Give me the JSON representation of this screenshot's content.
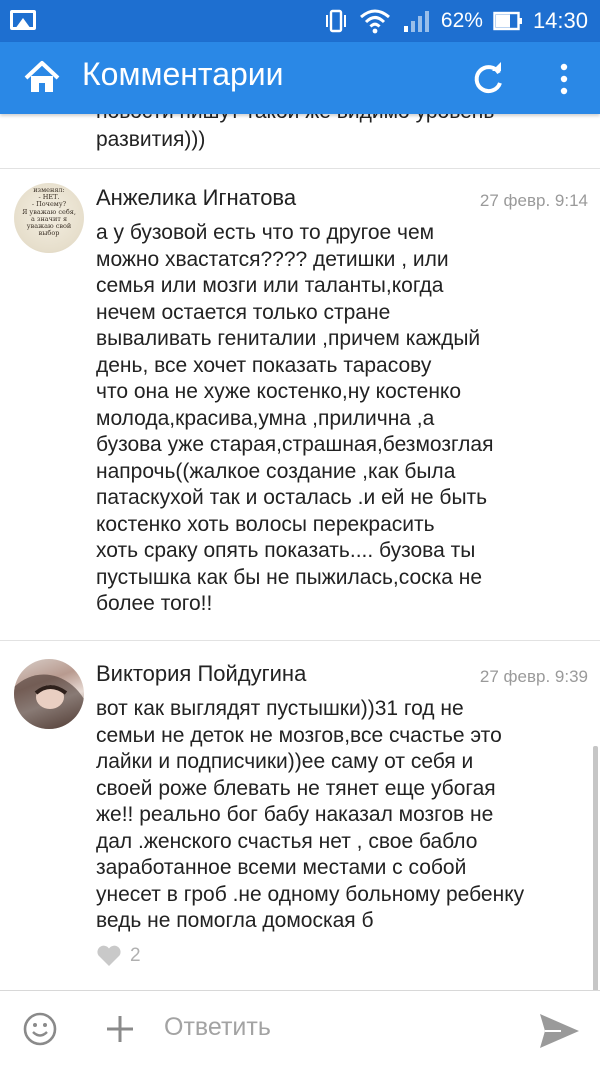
{
  "status_bar": {
    "battery": "62%",
    "time": "14:30",
    "icons": [
      "gallery-icon",
      "vibrate-icon",
      "wifi-icon",
      "signal-icon",
      "battery-icon"
    ]
  },
  "app_bar": {
    "title": "Комментарии",
    "icons": [
      "home-icon",
      "refresh-icon",
      "more-icon"
    ],
    "color": "#2a88e6"
  },
  "partial_comment": {
    "text": "новости пишут такой же видимо уровень\nразвития)))"
  },
  "comments": [
    {
      "author": "Анжелика Игнатова",
      "time": "27 февр. 9:14",
      "avatar_text": "изменял:\n- НЕТ.\n- Почему?\nЯ уважаю себя,\nа значит я\nуважаю свой\nвыбор",
      "text": "а у бузовой есть что то другое чем\nможно хвастатся???? детишки , или\nсемья или мозги или таланты,когда\nнечем остается только стране\nвываливать гениталии ,причем каждый\nдень, все хочет показать тарасову\nчто она не хуже костенко,ну костенко\nмолода,красива,умна ,прилична ,а\nбузова уже старая,страшная,безмозглая\nнапрочь((жалкое создание ,как была\nпатаскухой так и осталась .и ей не быть\nкостенко хоть волосы перекрасить\nхоть сраку опять показать.... бузова ты\nпустышка как бы не пыжилась,соска не\nболее того!!"
    },
    {
      "author": "Виктория Пойдугина",
      "time": "27 февр. 9:39",
      "text": "вот как выглядят пустышки))31 год не\nсемьи не деток не мозгов,все счастье это\nлайки и подписчики))ее саму от себя и\nсвоей роже блевать не тянет еще убогая\nже!! реально бог бабу наказал мозгов не\nдал .женского счастья нет , свое бабло\nзаработанное всеми местами с собой\nунесет в гроб .не одному больному ребенку\nведь не помогла домоская б",
      "likes": "2"
    }
  ],
  "bottom_bar": {
    "reply_placeholder": "Ответить",
    "icons": [
      "emoji-icon",
      "attach-plus-icon",
      "send-icon"
    ]
  }
}
